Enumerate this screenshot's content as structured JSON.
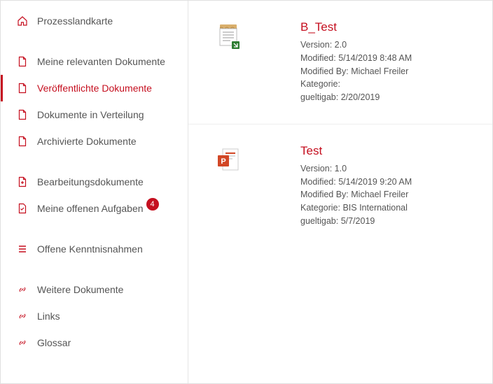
{
  "sidebar": {
    "groups": [
      [
        {
          "id": "prozesslandkarte",
          "label": "Prozesslandkarte",
          "icon": "home",
          "active": false
        }
      ],
      [
        {
          "id": "relevante",
          "label": "Meine relevanten Dokumente",
          "icon": "doc",
          "active": false
        },
        {
          "id": "veroeffentlichte",
          "label": "Veröffentlichte Dokumente",
          "icon": "doc",
          "active": true
        },
        {
          "id": "verteilung",
          "label": "Dokumente in Verteilung",
          "icon": "doc",
          "active": false
        },
        {
          "id": "archivierte",
          "label": "Archivierte Dokumente",
          "icon": "doc",
          "active": false
        }
      ],
      [
        {
          "id": "bearbeitung",
          "label": "Bearbeitungsdokumente",
          "icon": "docplus",
          "active": false
        },
        {
          "id": "aufgaben",
          "label": "Meine offenen Aufgaben",
          "icon": "task",
          "active": false,
          "badge": "4"
        }
      ],
      [
        {
          "id": "kenntnis",
          "label": "Offene Kenntnisnahmen",
          "icon": "list",
          "active": false
        }
      ],
      [
        {
          "id": "weitere",
          "label": "Weitere Dokumente",
          "icon": "link",
          "active": false
        },
        {
          "id": "links",
          "label": "Links",
          "icon": "link",
          "active": false
        },
        {
          "id": "glossar",
          "label": "Glossar",
          "icon": "link",
          "active": false
        }
      ]
    ]
  },
  "labels": {
    "version": "Version:",
    "modified": "Modified:",
    "modifiedBy": "Modified By:",
    "kategorie": "Kategorie:",
    "gueltigab": "gueltigab:"
  },
  "documents": [
    {
      "title": "B_Test",
      "icon": "text",
      "version": "2.0",
      "modified": "5/14/2019 8:48 AM",
      "modifiedBy": "Michael Freiler",
      "kategorie": "",
      "gueltigab": "2/20/2019"
    },
    {
      "title": "Test",
      "icon": "ppt",
      "version": "1.0",
      "modified": "5/14/2019 9:20 AM",
      "modifiedBy": "Michael Freiler",
      "kategorie": "BIS International",
      "gueltigab": "5/7/2019"
    }
  ]
}
